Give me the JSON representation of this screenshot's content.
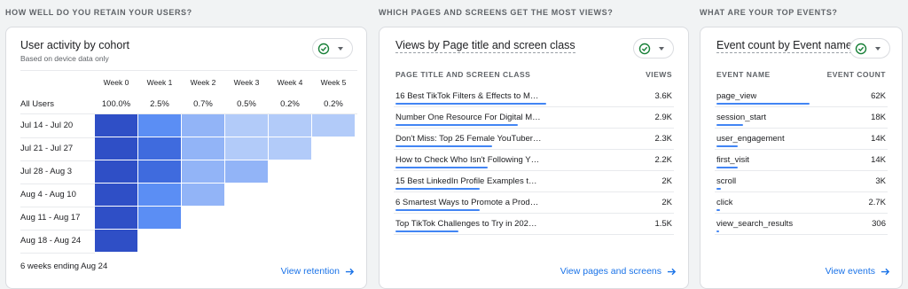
{
  "sections": {
    "retention_title": "HOW WELL DO YOU RETAIN YOUR USERS?",
    "pages_title": "WHICH PAGES AND SCREENS GET THE MOST VIEWS?",
    "events_title": "WHAT ARE YOUR TOP EVENTS?"
  },
  "cohort": {
    "title": "User activity by cohort",
    "subtitle": "Based on device data only",
    "weeks": [
      "Week 0",
      "Week 1",
      "Week 2",
      "Week 3",
      "Week 4",
      "Week 5"
    ],
    "all_users_label": "All Users",
    "all_users_values": [
      "100.0%",
      "2.5%",
      "0.7%",
      "0.5%",
      "0.2%",
      "0.2%"
    ],
    "rows": [
      "Jul 14 - Jul 20",
      "Jul 21 - Jul 27",
      "Jul 28 - Aug 3",
      "Aug 4 - Aug 10",
      "Aug 11 - Aug 17",
      "Aug 18 - Aug 24"
    ],
    "cell_colors": [
      [
        "#2f4fc6",
        "#5b8ef4",
        "#92b4f7",
        "#b2cbf9",
        "#b2cbf9",
        "#b2cbf9"
      ],
      [
        "#2f4fc6",
        "#3f6bde",
        "#92b4f7",
        "#b2cbf9",
        "#b2cbf9"
      ],
      [
        "#2f4fc6",
        "#3f6bde",
        "#92b4f7",
        "#92b4f7"
      ],
      [
        "#2f4fc6",
        "#5b8ef4",
        "#92b4f7"
      ],
      [
        "#2f4fc6",
        "#5b8ef4"
      ],
      [
        "#2f4fc6"
      ]
    ],
    "footnote": "6 weeks ending Aug 24",
    "link": "View retention"
  },
  "pages": {
    "title": "Views by Page title and screen class",
    "col_left": "PAGE TITLE AND SCREEN CLASS",
    "col_right": "VIEWS",
    "rows": [
      {
        "label": "16 Best TikTok Filters & Effects to M…",
        "value": "3.6K",
        "fraction": 1.0
      },
      {
        "label": "Number One Resource For Digital M…",
        "value": "2.9K",
        "fraction": 0.81
      },
      {
        "label": "Don't Miss: Top 25 Female YouTuber…",
        "value": "2.3K",
        "fraction": 0.64
      },
      {
        "label": "How to Check Who Isn't Following Y…",
        "value": "2.2K",
        "fraction": 0.61
      },
      {
        "label": "15 Best LinkedIn Profile Examples t…",
        "value": "2K",
        "fraction": 0.56
      },
      {
        "label": "6 Smartest Ways to Promote a Prod…",
        "value": "2K",
        "fraction": 0.56
      },
      {
        "label": "Top TikTok Challenges to Try in 202…",
        "value": "1.5K",
        "fraction": 0.42
      }
    ],
    "link": "View pages and screens"
  },
  "events": {
    "title": "Event count by Event name",
    "col_left": "EVENT NAME",
    "col_right": "EVENT COUNT",
    "rows": [
      {
        "label": "page_view",
        "value": "62K",
        "fraction": 1.0
      },
      {
        "label": "session_start",
        "value": "18K",
        "fraction": 0.29
      },
      {
        "label": "user_engagement",
        "value": "14K",
        "fraction": 0.23
      },
      {
        "label": "first_visit",
        "value": "14K",
        "fraction": 0.23
      },
      {
        "label": "scroll",
        "value": "3K",
        "fraction": 0.05
      },
      {
        "label": "click",
        "value": "2.7K",
        "fraction": 0.04
      },
      {
        "label": "view_search_results",
        "value": "306",
        "fraction": 0.005
      }
    ],
    "link": "View events"
  },
  "colors": {
    "accent": "#1a73e8",
    "bar": "#4285f4",
    "check": "#188038"
  },
  "icons": {
    "status": "check-circle-icon",
    "dropdown": "caret-down-icon",
    "link": "arrow-right-icon"
  }
}
